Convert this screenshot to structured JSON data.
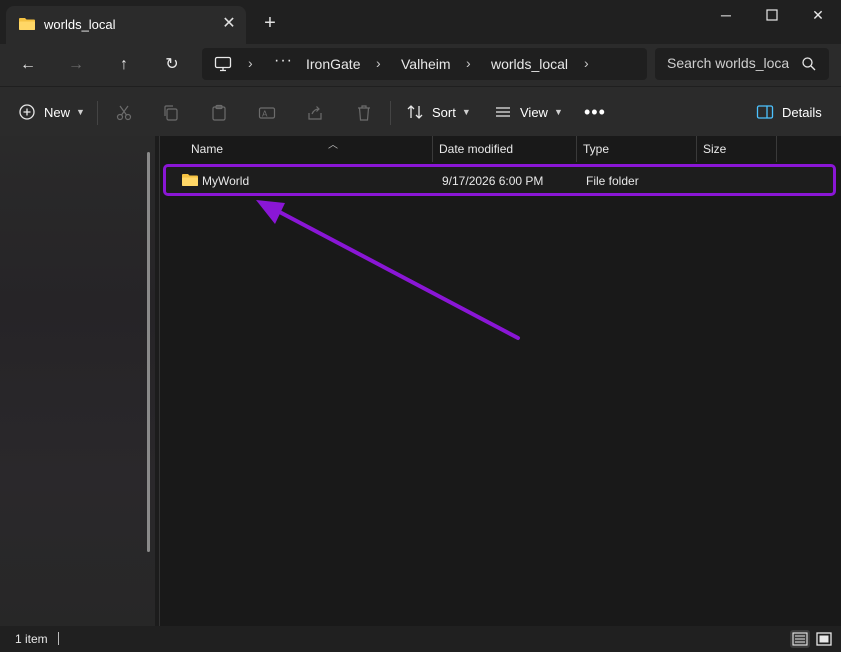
{
  "tab": {
    "title": "worlds_local",
    "icon": "folder-icon"
  },
  "window": {
    "minimize": "minimize-icon",
    "maximize": "maximize-icon",
    "close": "close-icon"
  },
  "breadcrumbs": [
    "IronGate",
    "Valheim",
    "worlds_local"
  ],
  "search": {
    "placeholder": "Search worlds_loca"
  },
  "commands": {
    "new_label": "New",
    "sort_label": "Sort",
    "view_label": "View",
    "details_label": "Details"
  },
  "columns": {
    "name": "Name",
    "date": "Date modified",
    "type": "Type",
    "size": "Size"
  },
  "files": [
    {
      "name": "MyWorld",
      "date": "9/17/2026 6:00 PM",
      "type": "File folder",
      "size": ""
    }
  ],
  "status": {
    "item_count": "1 item"
  },
  "colors": {
    "highlight": "#8a16d6",
    "folder": "#f5c242",
    "accent": "#4cc2ff"
  }
}
